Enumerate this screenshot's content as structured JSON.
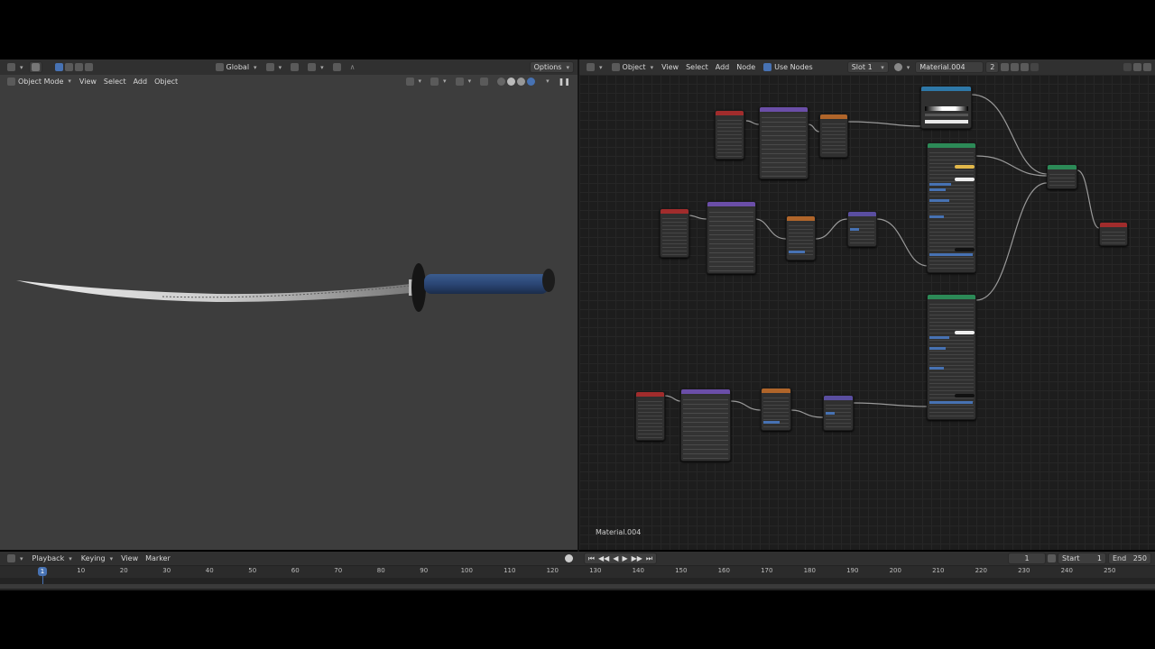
{
  "viewport_header": {
    "orientation": "Global",
    "mode": "Object Mode",
    "menus": [
      "View",
      "Select",
      "Add",
      "Object"
    ],
    "options": "Options"
  },
  "node_header": {
    "object": "Object",
    "menus": [
      "View",
      "Select",
      "Add",
      "Node"
    ],
    "use_nodes": "Use Nodes",
    "slot": "Slot 1",
    "material": "Material.004",
    "users": "2"
  },
  "node_editor": {
    "material_label": "Material.004"
  },
  "timeline": {
    "menus": [
      "Playback",
      "Keying",
      "View",
      "Marker"
    ],
    "current_frame": "1",
    "start_label": "Start",
    "start": "1",
    "end_label": "End",
    "end": "250",
    "ticks": [
      "1",
      "10",
      "20",
      "30",
      "40",
      "50",
      "60",
      "70",
      "80",
      "90",
      "100",
      "110",
      "120",
      "130",
      "140",
      "150",
      "160",
      "170",
      "180",
      "190",
      "200",
      "210",
      "220",
      "230",
      "240",
      "250"
    ]
  },
  "colors": {
    "accent": "#4772b3",
    "texture_coord": "#a12c2c",
    "mapping": "#6b4ea8",
    "texture": "#b0652a",
    "bump": "#5a4ea0",
    "bsdf": "#2c8a57",
    "colorramp": "#2e78a8",
    "shader": "#2c8a57",
    "output": "#a12c2c"
  }
}
